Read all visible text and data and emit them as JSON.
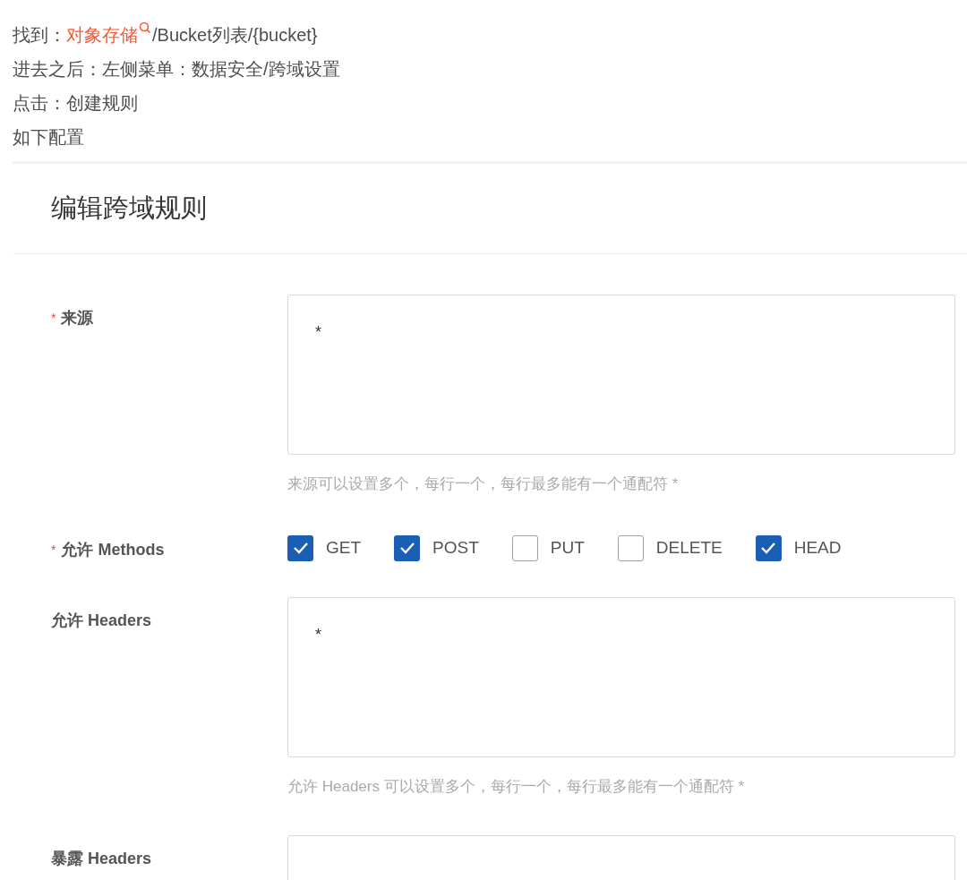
{
  "instructions": [
    {
      "prefix": "找到：",
      "link": "对象存储",
      "suffix": "/Bucket列表/{bucket}"
    },
    {
      "prefix": "进去之后：左侧菜单：数据安全/跨域设置"
    },
    {
      "prefix": "点击：创建规则"
    },
    {
      "prefix": "如下配置"
    }
  ],
  "dialog": {
    "title": "编辑跨域规则",
    "fields": [
      {
        "kind": "textarea",
        "label": "来源",
        "required": true,
        "value": "*",
        "help": "来源可以设置多个，每行一个，每行最多能有一个通配符 *"
      },
      {
        "kind": "checkboxes",
        "label": "允许 Methods",
        "required": true,
        "options": [
          {
            "label": "GET",
            "checked": true
          },
          {
            "label": "POST",
            "checked": true
          },
          {
            "label": "PUT",
            "checked": false
          },
          {
            "label": "DELETE",
            "checked": false
          },
          {
            "label": "HEAD",
            "checked": true
          }
        ]
      },
      {
        "kind": "textarea",
        "label": "允许 Headers",
        "required": false,
        "value": "*",
        "help": "允许 Headers 可以设置多个，每行一个，每行最多能有一个通配符 *"
      },
      {
        "kind": "textarea",
        "label": "暴露 Headers",
        "required": false
      }
    ]
  }
}
